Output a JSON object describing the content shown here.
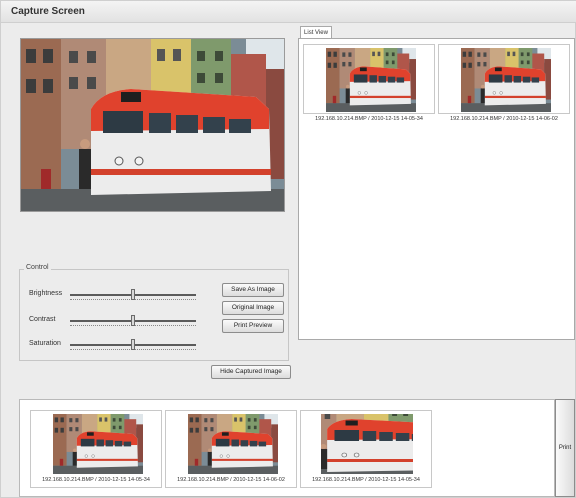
{
  "window": {
    "title": "Capture Screen"
  },
  "control": {
    "legend": "Control",
    "sliders": [
      {
        "label": "Brightness",
        "value": 0.5
      },
      {
        "label": "Contrast",
        "value": 0.5
      },
      {
        "label": "Saturation",
        "value": 0.5
      }
    ]
  },
  "buttons": {
    "save_as_image": "Save As Image",
    "original_image": "Original Image",
    "print_preview": "Print Preview",
    "hide_captured": "Hide Captured Image",
    "print": "Print"
  },
  "list_view": {
    "tab": "List View",
    "items": [
      {
        "caption": "192.168.10.214.BMP / 2010-12-15 14-05-34"
      },
      {
        "caption": "192.168.10.214.BMP / 2010-12-15 14-06-02"
      }
    ]
  },
  "captured": {
    "items": [
      {
        "caption": "192.168.10.214.BMP / 2010-12-15 14-05-34"
      },
      {
        "caption": "192.168.10.214.BMP / 2010-12-15 14-06-02"
      },
      {
        "caption": "192.168.10.214.BMP / 2010-12-15 14-05-34"
      }
    ]
  }
}
